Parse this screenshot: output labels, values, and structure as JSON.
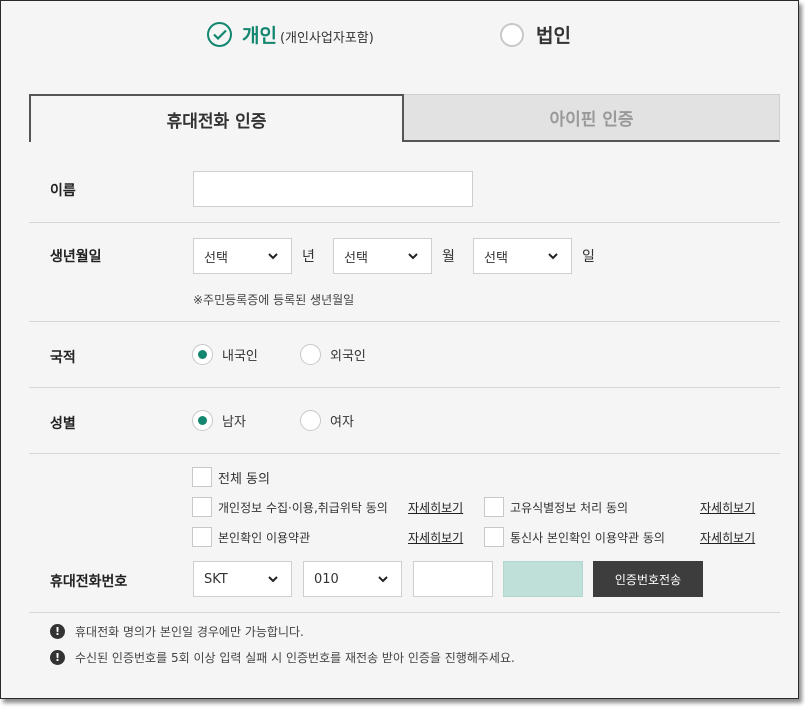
{
  "member_type": {
    "personal_label": "개인",
    "personal_sub": "(개인사업자포함)",
    "corporate_label": "법인",
    "selected": "personal"
  },
  "tabs": {
    "phone_auth": "휴대전화 인증",
    "ipin_auth": "아이핀 인증",
    "active": "phone_auth"
  },
  "form": {
    "name_label": "이름",
    "name_value": "",
    "birth_label": "생년월일",
    "year_select": "선택",
    "year_unit": "년",
    "month_select": "선택",
    "month_unit": "월",
    "day_select": "선택",
    "day_unit": "일",
    "birth_hint": "※주민등록증에 등록된 생년월일",
    "nationality_label": "국적",
    "nationality_options": [
      "내국인",
      "외국인"
    ],
    "nationality_selected": "내국인",
    "gender_label": "성별",
    "gender_options": [
      "남자",
      "여자"
    ],
    "gender_selected": "남자"
  },
  "agreements": {
    "all": "전체 동의",
    "items": [
      {
        "label": "개인정보 수집·이용,취급위탁 동의",
        "detail": "자세히보기"
      },
      {
        "label": "고유식별정보 처리 동의",
        "detail": "자세히보기"
      },
      {
        "label": "본인확인 이용약관",
        "detail": "자세히보기"
      },
      {
        "label": "통신사 본인확인 이용약관 동의",
        "detail": "자세히보기"
      }
    ]
  },
  "phone": {
    "label": "휴대전화번호",
    "carrier": "SKT",
    "prefix": "010",
    "middle": "",
    "last": "",
    "send_button": "인증번호전송"
  },
  "notices": [
    "휴대전화 명의가 본인일 경우에만 가능합니다.",
    "수신된 인증번호를 5회 이상 입력 실패 시 인증번호를 재전송 받아 인증을 진행해주세요."
  ],
  "colors": {
    "accent": "#13866f",
    "button_dark": "#3d3d3d",
    "input_disabled": "#bfe0d8"
  },
  "icons": {
    "check_circle": "check-circle-icon",
    "chevron": "chevron-down-icon",
    "notice": "exclamation-icon"
  }
}
